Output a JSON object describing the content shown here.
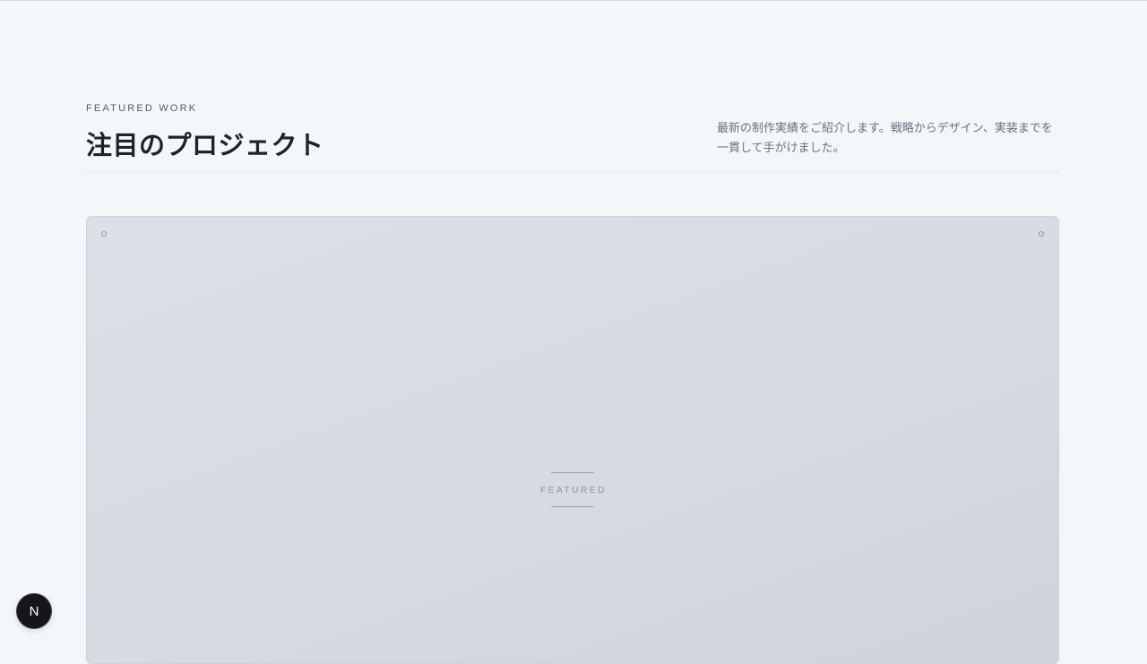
{
  "section": {
    "eyebrow": "FEATURED WORK",
    "title": "注目のプロジェクト",
    "description": "最新の制作実績をご紹介します。戦略からデザイン、実装までを一貫して手がけました。"
  },
  "featured_card": {
    "label": "FEATURED"
  },
  "dev_badge": {
    "letter": "N"
  },
  "colors": {
    "background": "#f4f7fa",
    "title": "#1f2329",
    "card": "#d6dae1",
    "badge": "#15161a"
  }
}
